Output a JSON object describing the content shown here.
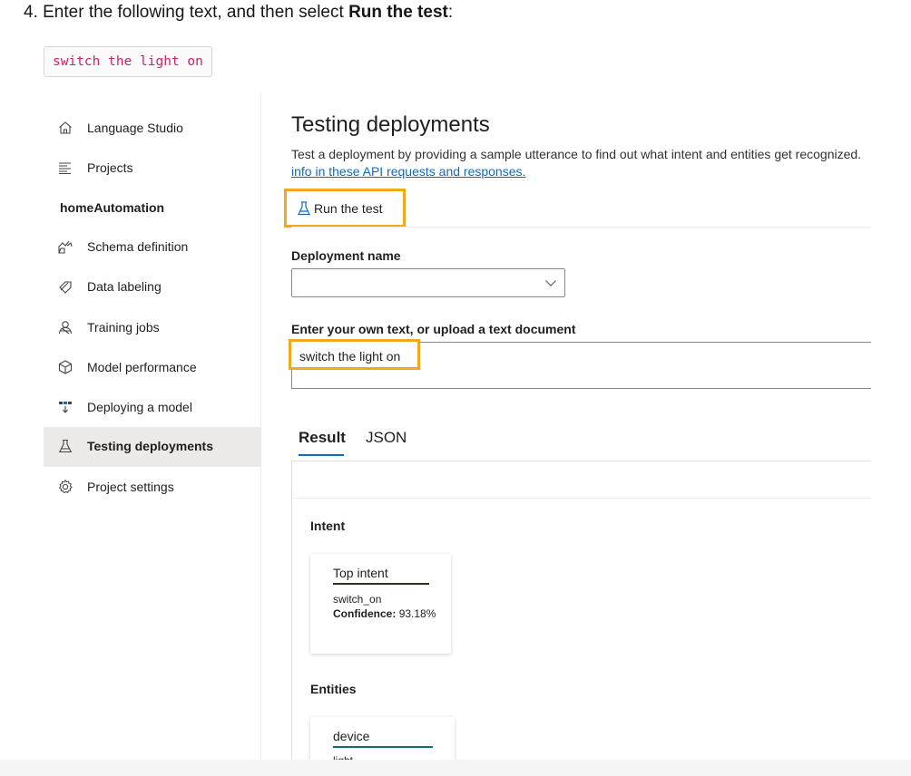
{
  "instruction": {
    "prefix": "4. Enter the following text, and then select ",
    "bold": "Run the test",
    "suffix": ":"
  },
  "code_snippet": "switch the light on",
  "sidebar": {
    "items": [
      {
        "label": "Language Studio",
        "icon": "home-icon"
      },
      {
        "label": "Projects",
        "icon": "list-icon"
      }
    ],
    "project_name": "homeAutomation",
    "project_items": [
      {
        "label": "Schema definition",
        "icon": "schema-icon"
      },
      {
        "label": "Data labeling",
        "icon": "tag-icon"
      },
      {
        "label": "Training jobs",
        "icon": "training-icon"
      },
      {
        "label": "Model performance",
        "icon": "cube-icon"
      },
      {
        "label": "Deploying a model",
        "icon": "deploy-icon"
      },
      {
        "label": "Testing deployments",
        "icon": "beaker-icon",
        "active": true
      },
      {
        "label": "Project settings",
        "icon": "gear-icon"
      }
    ]
  },
  "main": {
    "title": "Testing deployments",
    "description": "Test a deployment by providing a sample utterance to find out what intent and entities get recognized.",
    "link_text": "info in these API requests and responses.",
    "run_button": "Run the test",
    "deployment_label": "Deployment name",
    "deployment_value": "",
    "text_label": "Enter your own text, or upload a text document",
    "text_value": "switch the light on",
    "tabs": [
      {
        "label": "Result",
        "active": true
      },
      {
        "label": "JSON",
        "active": false
      }
    ],
    "result": {
      "intent_section": "Intent",
      "intent_card": {
        "title": "Top intent",
        "name": "switch_on",
        "confidence_label": "Confidence:",
        "confidence_value": "93.18%"
      },
      "entities_section": "Entities",
      "entity_card": {
        "title": "device",
        "value": "light"
      }
    }
  },
  "colors": {
    "highlight": "#f0a81c",
    "link": "#0f6cbd",
    "code_text": "#d0206a",
    "active_nav": "#ebeae9"
  }
}
